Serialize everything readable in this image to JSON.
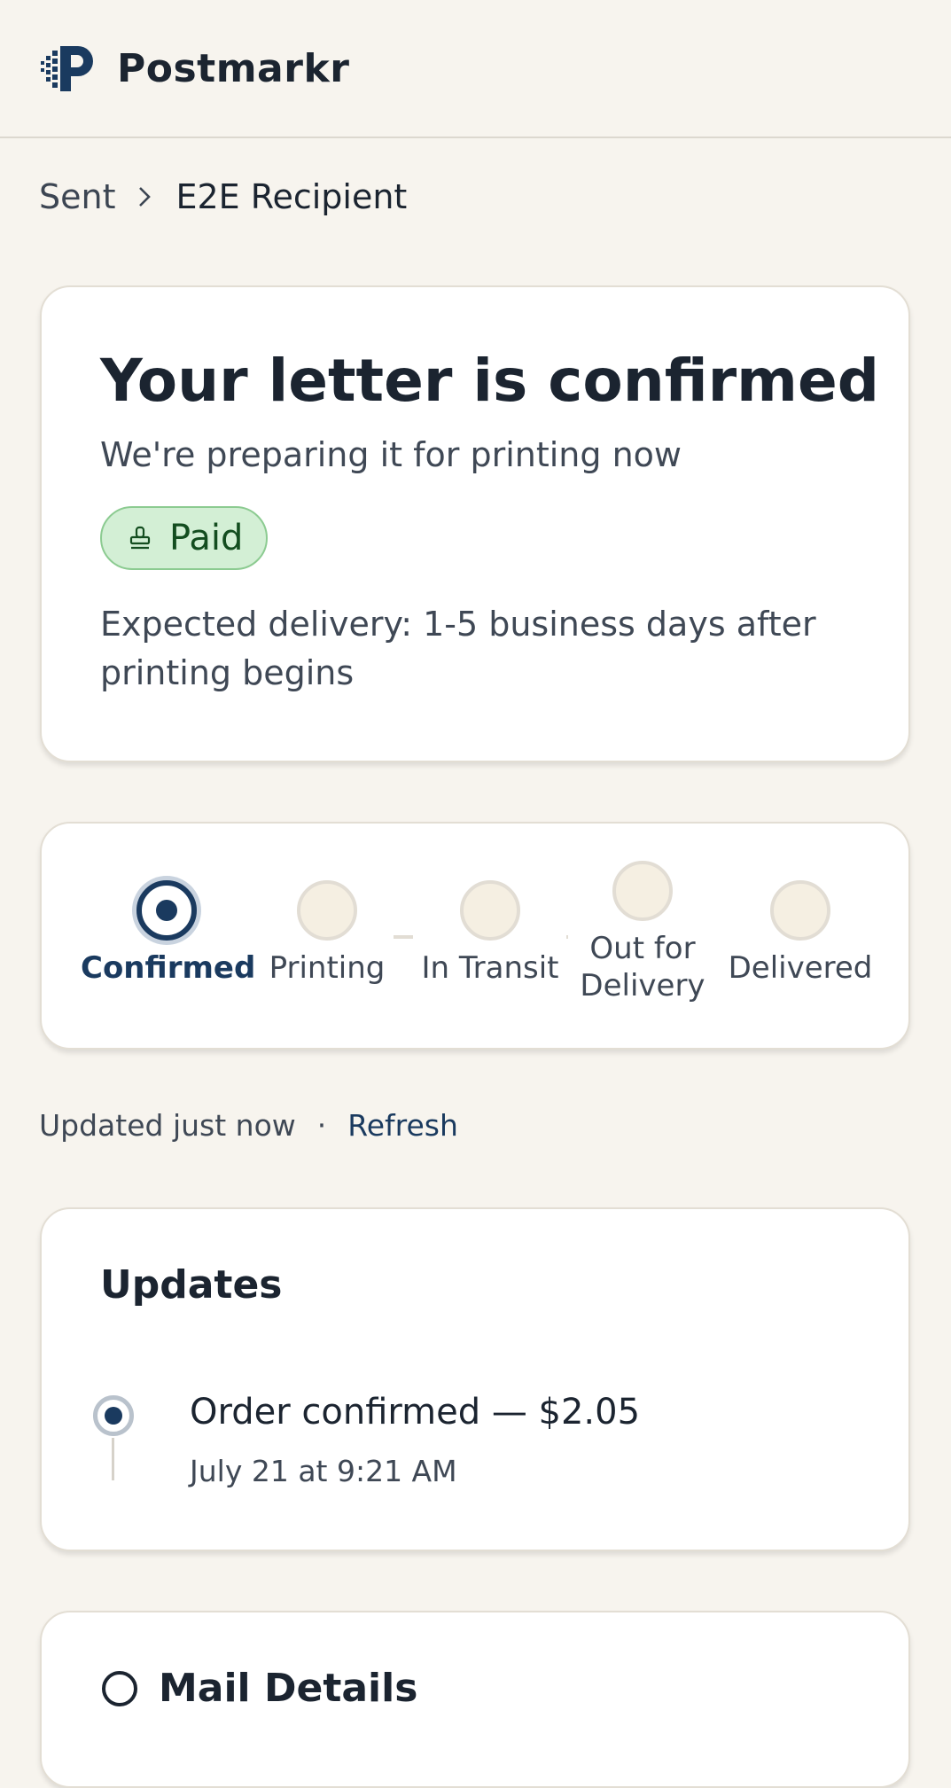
{
  "header": {
    "brand": "Postmarkr",
    "logo_icon": "postmarkr-logo-icon"
  },
  "breadcrumb": {
    "root": "Sent",
    "separator_icon": "chevron-right-icon",
    "current": "E2E Recipient"
  },
  "confirmation": {
    "title": "Your letter is confirmed",
    "subtitle": "We're preparing it for printing now",
    "badge": {
      "icon": "stamp-icon",
      "label": "Paid",
      "bg": "#d3efd5",
      "text_color": "#134d1f"
    },
    "delivery_text": "Expected delivery: 1-5 business days after printing begins"
  },
  "progress": {
    "steps": [
      {
        "label": "Confirmed",
        "state": "active"
      },
      {
        "label": "Printing",
        "state": "pending"
      },
      {
        "label": "In Transit",
        "state": "pending"
      },
      {
        "label": "Out for\nDelivery",
        "state": "pending"
      },
      {
        "label": "Delivered",
        "state": "pending"
      }
    ],
    "accent": "#1a3a5f"
  },
  "status": {
    "updated": "Updated just now",
    "separator": "·",
    "refresh_label": "Refresh"
  },
  "updates": {
    "title": "Updates",
    "items": [
      {
        "text": "Order confirmed — $2.05",
        "time": "July 21 at 9:21 AM"
      }
    ]
  },
  "mail_card": {
    "icon": "mail-icon",
    "title": "Mail Details"
  }
}
